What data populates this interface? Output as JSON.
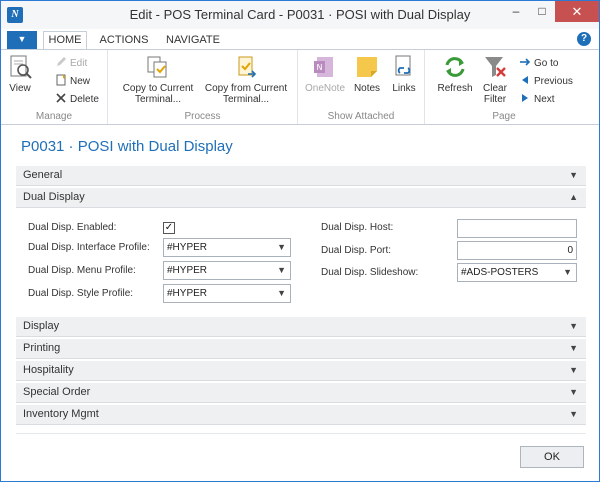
{
  "window": {
    "title": "Edit - POS Terminal Card - P0031 · POSI with Dual Display",
    "app_icon_text": "N",
    "minimize": "–",
    "maximize": "□",
    "close": "✕"
  },
  "ribbon_tabs": {
    "menu_glyph": "▼",
    "home": "HOME",
    "actions": "ACTIONS",
    "navigate": "NAVIGATE",
    "help": "?"
  },
  "ribbon": {
    "manage": {
      "label": "Manage",
      "view": "View",
      "edit": "Edit",
      "new": "New",
      "delete": "Delete"
    },
    "process": {
      "label": "Process",
      "copy_to": "Copy to Current Terminal...",
      "copy_from": "Copy from Current Terminal..."
    },
    "show_attached": {
      "label": "Show Attached",
      "onenote": "OneNote",
      "notes": "Notes",
      "links": "Links"
    },
    "page": {
      "label": "Page",
      "refresh": "Refresh",
      "clear_filter": "Clear Filter",
      "go_to": "Go to",
      "previous": "Previous",
      "next": "Next"
    }
  },
  "page_title": "P0031 · POSI with Dual Display",
  "fasttabs": {
    "general": "General",
    "dual_display": "Dual Display",
    "display": "Display",
    "printing": "Printing",
    "hospitality": "Hospitality",
    "special_order": "Special Order",
    "inventory_mgmt": "Inventory Mgmt"
  },
  "dual_display": {
    "enabled_label": "Dual Disp. Enabled:",
    "enabled_checked": "✓",
    "interface_profile_label": "Dual Disp. Interface Profile:",
    "interface_profile_value": "#HYPER",
    "menu_profile_label": "Dual Disp. Menu Profile:",
    "menu_profile_value": "#HYPER",
    "style_profile_label": "Dual Disp. Style Profile:",
    "style_profile_value": "#HYPER",
    "host_label": "Dual Disp. Host:",
    "host_value": "",
    "port_label": "Dual Disp. Port:",
    "port_value": "0",
    "slideshow_label": "Dual Disp. Slideshow:",
    "slideshow_value": "#ADS-POSTERS"
  },
  "ok_button": "OK",
  "colors": {
    "accent": "#1f6fb8",
    "close_red": "#c75050",
    "fasttab_bg": "#eef0f2"
  }
}
